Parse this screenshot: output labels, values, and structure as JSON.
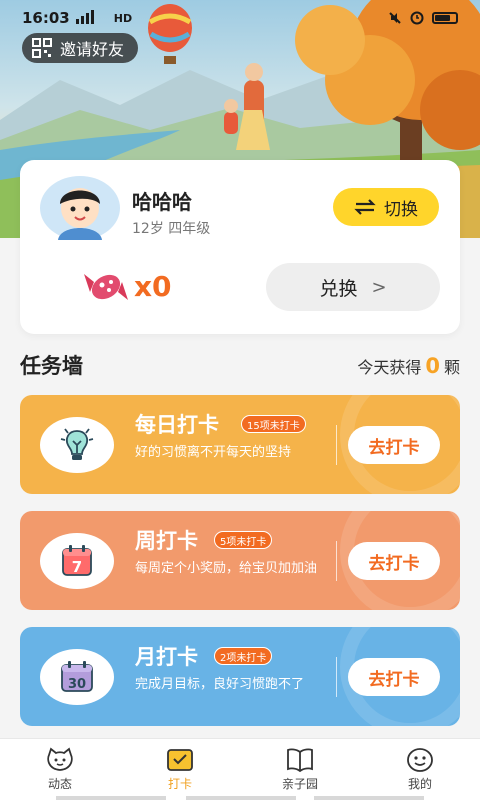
{
  "status_bar": {
    "time": "16:03",
    "network": "HD",
    "icons": [
      "notification-icon",
      "signal-icon",
      "mute-icon",
      "alarm-icon",
      "battery-icon"
    ]
  },
  "invite": {
    "label": "邀请好友",
    "icon": "qr-code-icon"
  },
  "profile": {
    "name": "哈哈哈",
    "info": "12岁 四年级",
    "switch_label": "切换",
    "candy_count": "x0",
    "redeem_label": "兑换",
    "redeem_chevron": ">"
  },
  "task_wall": {
    "title": "任务墙",
    "today_prefix": "今天获得",
    "today_count": "0",
    "today_unit": "颗"
  },
  "tasks": [
    {
      "title": "每日打卡",
      "badge": "15项未打卡",
      "desc": "好的习惯离不开每天的坚持",
      "button": "去打卡",
      "color": "#f5b34a",
      "icon": "lightbulb-icon"
    },
    {
      "title": "周打卡",
      "badge": "5项未打卡",
      "desc": "每周定个小奖励，给宝贝加加油",
      "button": "去打卡",
      "color": "#f29a6c",
      "icon": "calendar-7-icon",
      "icon_text": "7"
    },
    {
      "title": "月打卡",
      "badge": "2项未打卡",
      "desc": "完成月目标，良好习惯跑不了",
      "button": "去打卡",
      "color": "#68b3e6",
      "icon": "calendar-30-icon",
      "icon_text": "30"
    }
  ],
  "tabs": [
    {
      "label": "动态",
      "icon": "pet-face-icon",
      "active": false
    },
    {
      "label": "打卡",
      "icon": "check-in-icon",
      "active": true
    },
    {
      "label": "亲子园",
      "icon": "book-icon",
      "active": false
    },
    {
      "label": "我的",
      "icon": "smiley-icon",
      "active": false
    }
  ],
  "colors": {
    "accent": "#f26b21",
    "switch_yellow": "#ffd52b",
    "active_tab": "#f0a020"
  }
}
